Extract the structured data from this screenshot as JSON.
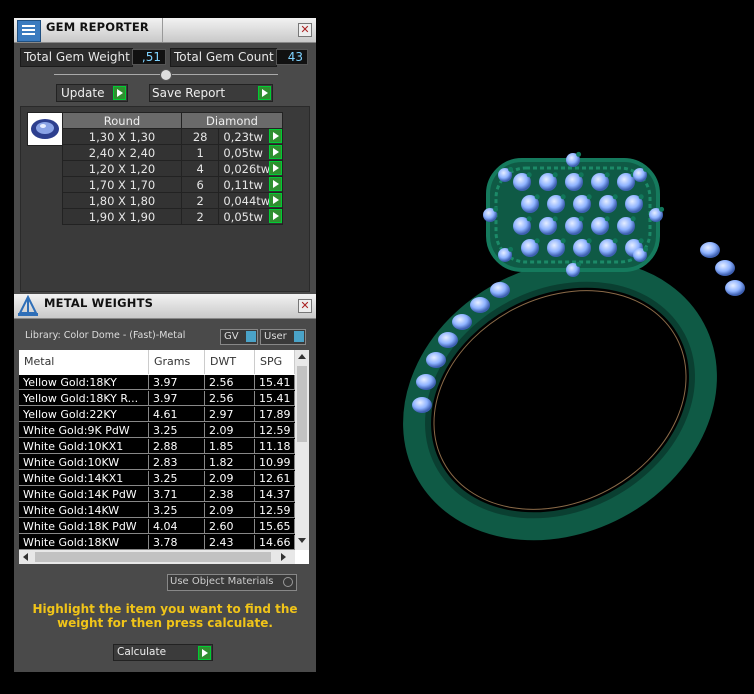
{
  "gem_reporter": {
    "title": "GEM REPORTER",
    "total_weight_label": "Total Gem Weight",
    "total_weight_value": ",51",
    "total_count_label": "Total Gem Count",
    "total_count_value": "43",
    "update_label": "Update",
    "save_report_label": "Save Report",
    "shape_header": "Round",
    "type_header": "Diamond",
    "rows": [
      {
        "size": "1,30 X 1,30",
        "count": "28",
        "weight": "0,23tw"
      },
      {
        "size": "2,40 X 2,40",
        "count": "1",
        "weight": "0,05tw"
      },
      {
        "size": "1,20 X 1,20",
        "count": "4",
        "weight": "0,026tw"
      },
      {
        "size": "1,70 X 1,70",
        "count": "6",
        "weight": "0,11tw"
      },
      {
        "size": "1,80 X 1,80",
        "count": "2",
        "weight": "0,044tw"
      },
      {
        "size": "1,90 X 1,90",
        "count": "2",
        "weight": "0,05tw"
      }
    ]
  },
  "metal_weights": {
    "title": "METAL WEIGHTS",
    "library": "Library: Color Dome - (Fast)-Metal",
    "gv_label": "GV",
    "user_label": "User",
    "headers": [
      "Metal",
      "Grams",
      "DWT",
      "SPG"
    ],
    "rows": [
      [
        "Yellow Gold:18KY",
        "3.97",
        "2.56",
        "15.41"
      ],
      [
        "Yellow Gold:18KY R...",
        "3.97",
        "2.56",
        "15.41"
      ],
      [
        "Yellow Gold:22KY",
        "4.61",
        "2.97",
        "17.89"
      ],
      [
        "White Gold:9K PdW",
        "3.25",
        "2.09",
        "12.59"
      ],
      [
        "White Gold:10KX1",
        "2.88",
        "1.85",
        "11.18"
      ],
      [
        "White Gold:10KW",
        "2.83",
        "1.82",
        "10.99"
      ],
      [
        "White Gold:14KX1",
        "3.25",
        "2.09",
        "12.61"
      ],
      [
        "White Gold:14K PdW",
        "3.71",
        "2.38",
        "14.37"
      ],
      [
        "White Gold:14KW",
        "3.25",
        "2.09",
        "12.59"
      ],
      [
        "White Gold:18K PdW",
        "4.04",
        "2.60",
        "15.65"
      ],
      [
        "White Gold:18KW",
        "3.78",
        "2.43",
        "14.66"
      ]
    ],
    "use_object_materials": "Use Object Materials",
    "instruction": "Highlight the item you want to find the weight for then press calculate.",
    "calculate_label": "Calculate"
  },
  "colors": {
    "panel": "#4a4a4a",
    "accent_green": "#2f8f2f",
    "note_yellow": "#f0c419",
    "ring_green": "#0f5a45",
    "gem_blue": "#8fb3ff"
  }
}
